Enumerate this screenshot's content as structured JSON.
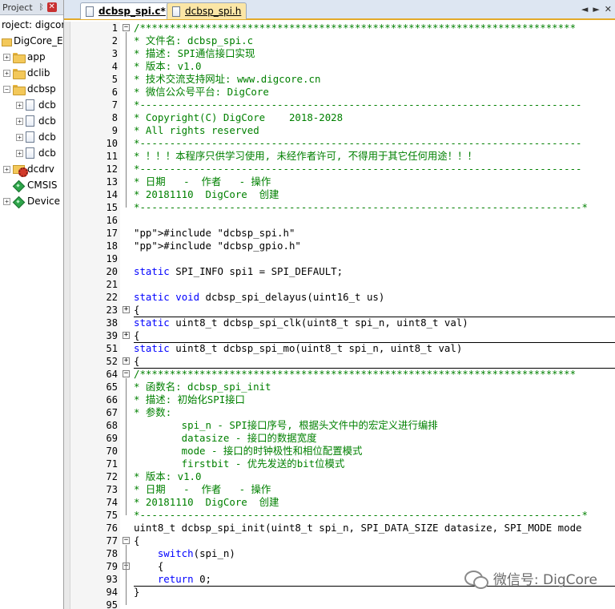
{
  "project": {
    "title": "Project",
    "pin": "ᛒ",
    "close": "✕",
    "root_label": "roject: digcore",
    "target_label": "DigCore_Em",
    "items": [
      {
        "label": "app",
        "icon": "folder-icon",
        "toggle": "+"
      },
      {
        "label": "dclib",
        "icon": "folder-icon",
        "toggle": "+"
      },
      {
        "label": "dcbsp",
        "icon": "folder-icon",
        "toggle": "−"
      },
      {
        "label": "dcb",
        "icon": "file-icon",
        "toggle": "+"
      },
      {
        "label": "dcb",
        "icon": "file-icon",
        "toggle": "+"
      },
      {
        "label": "dcb",
        "icon": "file-icon",
        "toggle": "+"
      },
      {
        "label": "dcb",
        "icon": "file-icon",
        "toggle": "+"
      },
      {
        "label": "dcdrv",
        "icon": "gear-folder-icon",
        "toggle": "+"
      },
      {
        "label": "CMSIS",
        "icon": "gem-icon",
        "toggle": ""
      },
      {
        "label": "Device",
        "icon": "gem-icon",
        "toggle": "+"
      }
    ]
  },
  "editor": {
    "tabs": [
      {
        "label": "dcbsp_spi.c*",
        "active": true
      },
      {
        "label": "dcbsp_spi.h",
        "active": false
      }
    ],
    "controls": [
      "◄",
      "►",
      "✕"
    ],
    "watermark": "微信号: DigCore"
  },
  "code": {
    "lines": [
      {
        "n": "1",
        "fold": "−",
        "text": "/*************************************************************************"
      },
      {
        "n": "2",
        "fold": "",
        "text": "* 文件名: dcbsp_spi.c"
      },
      {
        "n": "3",
        "fold": "",
        "text": "* 描述: SPI通信接口实现"
      },
      {
        "n": "4",
        "fold": "",
        "text": "* 版本: v1.0"
      },
      {
        "n": "5",
        "fold": "",
        "text": "* 技术交流支持网址: www.digcore.cn"
      },
      {
        "n": "6",
        "fold": "",
        "text": "* 微信公众号平台: DigCore"
      },
      {
        "n": "7",
        "fold": "",
        "text": "*--------------------------------------------------------------------------"
      },
      {
        "n": "8",
        "fold": "",
        "text": "* Copyright(C) DigCore    2018-2028"
      },
      {
        "n": "9",
        "fold": "",
        "text": "* All rights reserved"
      },
      {
        "n": "10",
        "fold": "",
        "text": "*--------------------------------------------------------------------------"
      },
      {
        "n": "11",
        "fold": "",
        "text": "* ！！！本程序只供学习使用, 未经作者许可, 不得用于其它任何用途！！！"
      },
      {
        "n": "12",
        "fold": "",
        "text": "*--------------------------------------------------------------------------"
      },
      {
        "n": "13",
        "fold": "",
        "text": "* 日期   -  作者   - 操作"
      },
      {
        "n": "14",
        "fold": "",
        "text": "* 20181110  DigCore  创建"
      },
      {
        "n": "15",
        "fold": "",
        "text": "*--------------------------------------------------------------------------*"
      },
      {
        "n": "16",
        "fold": "",
        "text": ""
      },
      {
        "n": "17",
        "fold": "",
        "text": "#include \"dcbsp_spi.h\""
      },
      {
        "n": "18",
        "fold": "",
        "text": "#include \"dcbsp_gpio.h\""
      },
      {
        "n": "19",
        "fold": "",
        "text": ""
      },
      {
        "n": "20",
        "fold": "",
        "text": "static SPI_INFO spi1 = SPI_DEFAULT;"
      },
      {
        "n": "21",
        "fold": "",
        "text": ""
      },
      {
        "n": "22",
        "fold": "",
        "text": "static void dcbsp_spi_delayus(uint16_t us)"
      },
      {
        "n": "23",
        "fold": "+",
        "text": "{"
      },
      {
        "n": "38",
        "fold": "",
        "text": "static uint8_t dcbsp_spi_clk(uint8_t spi_n, uint8_t val)"
      },
      {
        "n": "39",
        "fold": "+",
        "text": "{"
      },
      {
        "n": "51",
        "fold": "",
        "text": "static uint8_t dcbsp_spi_mo(uint8_t spi_n, uint8_t val)"
      },
      {
        "n": "52",
        "fold": "+",
        "text": "{"
      },
      {
        "n": "64",
        "fold": "−",
        "text": "/*************************************************************************"
      },
      {
        "n": "65",
        "fold": "",
        "text": "* 函数名: dcbsp_spi_init"
      },
      {
        "n": "66",
        "fold": "",
        "text": "* 描述: 初始化SPI接口"
      },
      {
        "n": "67",
        "fold": "",
        "text": "* 参数:"
      },
      {
        "n": "68",
        "fold": "",
        "text": "        spi_n - SPI接口序号, 根据头文件中的宏定义进行编排"
      },
      {
        "n": "69",
        "fold": "",
        "text": "        datasize - 接口的数据宽度"
      },
      {
        "n": "70",
        "fold": "",
        "text": "        mode - 接口的时钟极性和相位配置模式"
      },
      {
        "n": "71",
        "fold": "",
        "text": "        firstbit - 优先发送的bit位模式"
      },
      {
        "n": "72",
        "fold": "",
        "text": "* 版本: v1.0"
      },
      {
        "n": "73",
        "fold": "",
        "text": "* 日期   -  作者   - 操作"
      },
      {
        "n": "74",
        "fold": "",
        "text": "* 20181110  DigCore  创建"
      },
      {
        "n": "75",
        "fold": "",
        "text": "*--------------------------------------------------------------------------*"
      },
      {
        "n": "76",
        "fold": "",
        "text": "uint8_t dcbsp_spi_init(uint8_t spi_n, SPI_DATA_SIZE datasize, SPI_MODE mode"
      },
      {
        "n": "77",
        "fold": "−",
        "text": "{"
      },
      {
        "n": "78",
        "fold": "",
        "text": "    switch(spi_n)"
      },
      {
        "n": "79",
        "fold": "+",
        "text": "    {"
      },
      {
        "n": "93",
        "fold": "",
        "text": "    return 0;"
      },
      {
        "n": "94",
        "fold": "",
        "text": "}"
      },
      {
        "n": "95",
        "fold": "",
        "text": ""
      }
    ]
  }
}
